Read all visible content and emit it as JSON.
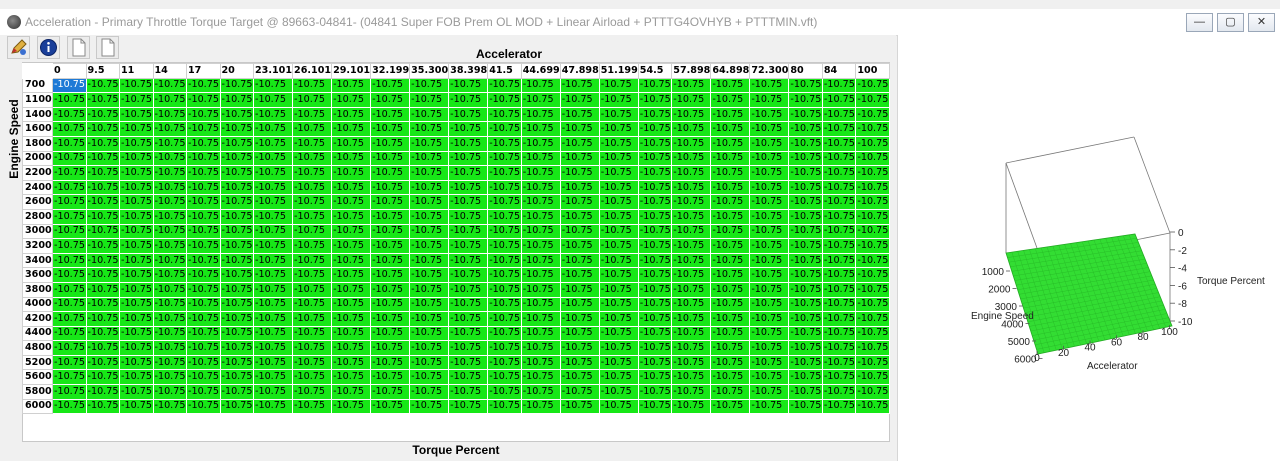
{
  "window": {
    "title": "Acceleration - Primary Throttle Torque Target @ 89663-04841- (04841 Super FOB Prem OL MOD + Linear Airload + PTTTG4OVHYB + PTTTMIN.vft)",
    "minimize_label": "—",
    "maximize_label": "▢",
    "close_label": "✕"
  },
  "toolbar": {
    "icons": [
      "edit-pencil-icon",
      "info-icon",
      "new-document-icon",
      "copy-document-icon"
    ]
  },
  "table": {
    "x_axis_label": "Accelerator",
    "y_axis_label": "Engine Speed",
    "z_axis_label": "Torque Percent",
    "x_headers": [
      "0",
      "9.5",
      "11",
      "14",
      "17",
      "20",
      "23.101",
      "26.101",
      "29.101",
      "32.199",
      "35.300",
      "38.398",
      "41.5",
      "44.699",
      "47.898",
      "51.199",
      "54.5",
      "57.898",
      "64.898",
      "72.300",
      "80",
      "84",
      "100"
    ],
    "y_headers": [
      "700",
      "1100",
      "1400",
      "1600",
      "1800",
      "2000",
      "2200",
      "2400",
      "2600",
      "2800",
      "3000",
      "3200",
      "3400",
      "3600",
      "3800",
      "4000",
      "4200",
      "4400",
      "4800",
      "5200",
      "5600",
      "5800",
      "6000"
    ],
    "cell_value": "-10.75",
    "selected_cell": {
      "row": 0,
      "col": 0
    },
    "colors": {
      "cell_fill": "#17e717",
      "selected_fill": "#1e7ad6"
    }
  },
  "chart3d": {
    "z_axis_label": "Torque Percent",
    "y_axis_label": "Engine Speed",
    "x_axis_label": "Accelerator",
    "z_ticks": [
      "0",
      "-2",
      "-4",
      "-6",
      "-8",
      "-10"
    ],
    "y_ticks": [
      "1000",
      "2000",
      "3000",
      "4000",
      "5000",
      "6000"
    ],
    "x_ticks": [
      "0",
      "20",
      "40",
      "60",
      "80",
      "100"
    ],
    "surface_color": "#33dd33"
  }
}
